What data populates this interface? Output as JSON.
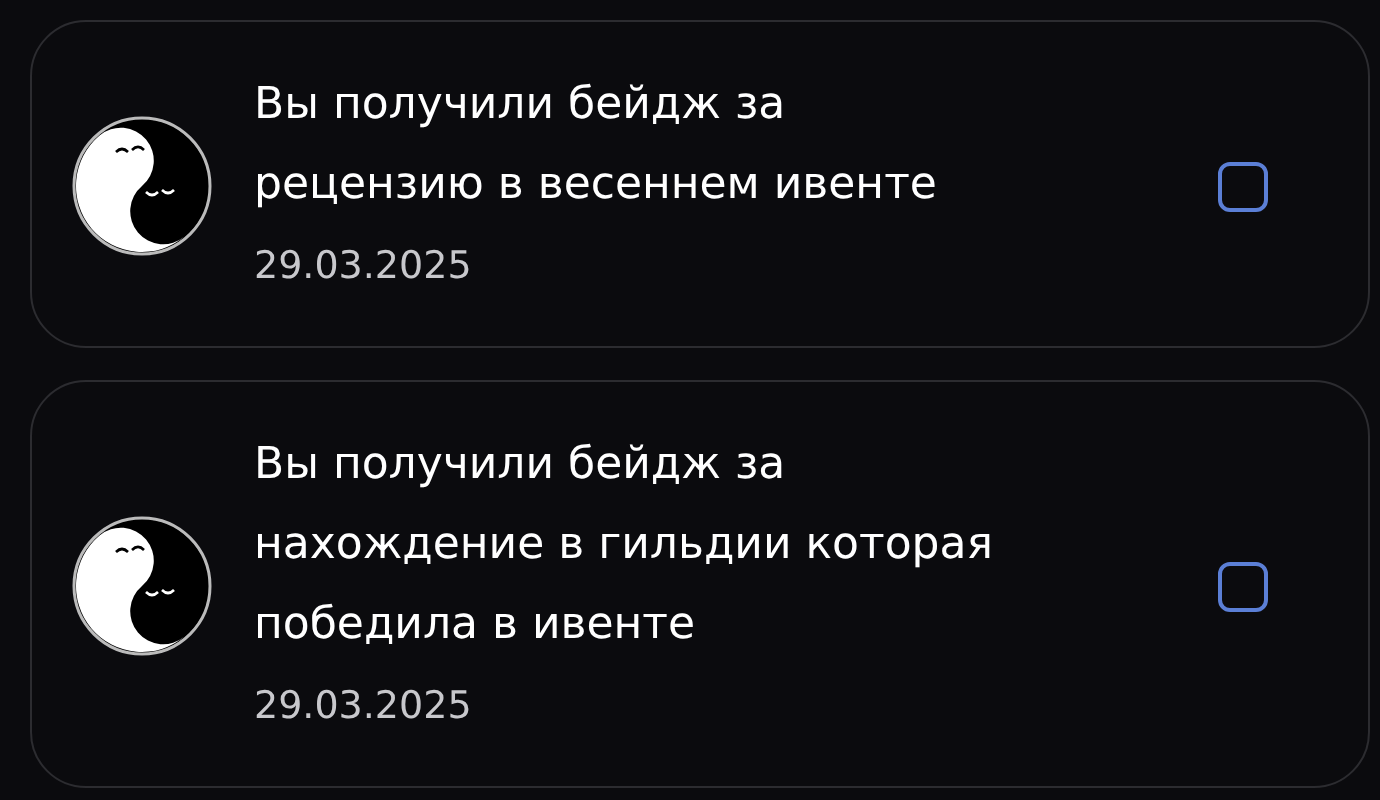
{
  "notifications": [
    {
      "text": "Вы получили бейдж за\nрецензию в весеннем ивенте",
      "date": "29.03.2025",
      "checked": false
    },
    {
      "text": "Вы получили бейдж за\nнахождение в гильдии которая\nпобедила в ивенте",
      "date": "29.03.2025",
      "checked": false
    }
  ]
}
